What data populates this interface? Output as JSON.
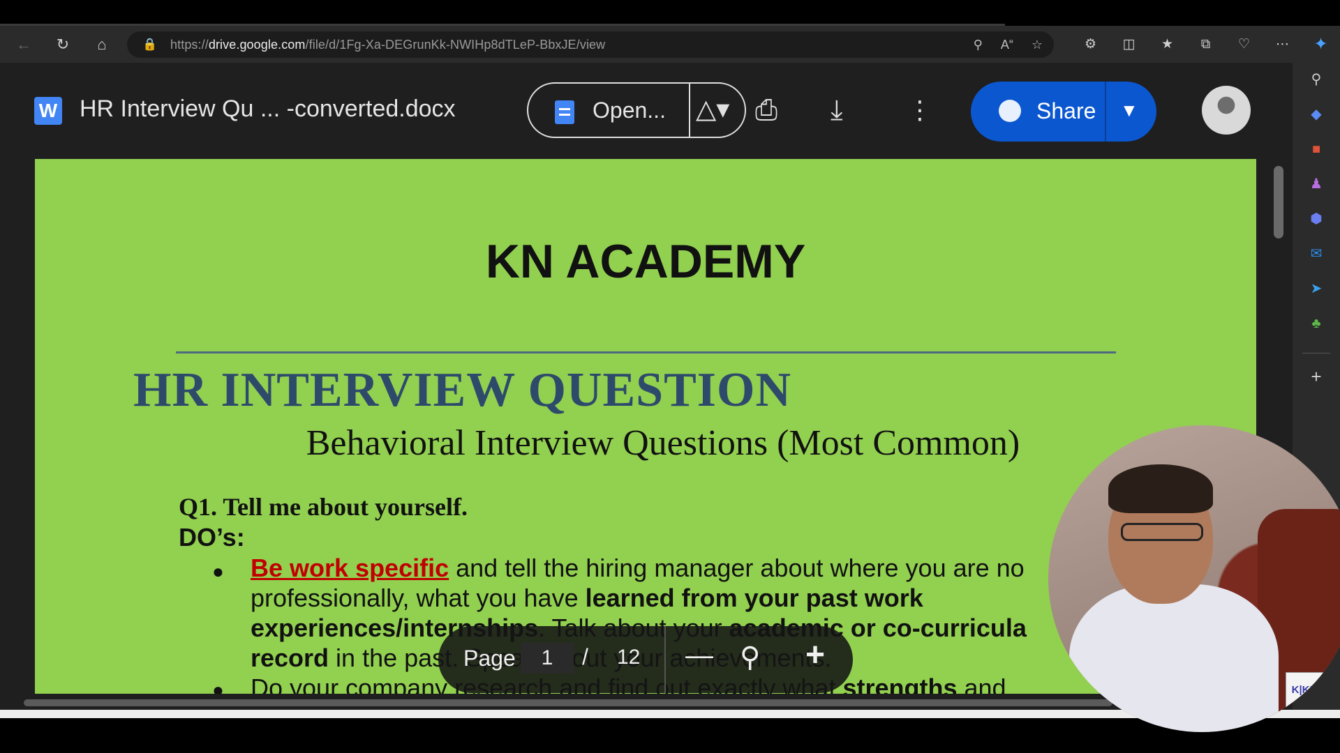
{
  "browser": {
    "url_prefix": "https://",
    "url_domain": "drive.google.com",
    "url_path": "/file/d/1Fg-Xa-DEGrunKk-NWIHp8dTLeP-BbxJE/view"
  },
  "drive": {
    "file_icon_letter": "W",
    "doc_title": "HR Interview Qu ... -converted.docx",
    "open_with_label": "Open...",
    "share_label": "Share"
  },
  "document": {
    "brand": "KN ACADEMY",
    "heading": "HR INTERVIEW QUESTION",
    "subheading": "Behavioral Interview Questions (Most Common)",
    "question": "Q1. Tell me about yourself.",
    "dos_label": "DO’s:",
    "bullet1": {
      "link": "Be work specific",
      "line1_rest": " and tell the hiring manager about where you are no",
      "line2_a": "professionally, what you have ",
      "line2_b": "learned from your past work",
      "line3_a": "experiences/internships",
      "line3_b": ". Talk about your ",
      "line3_c": "academic or co-curricula",
      "line4_a": "record",
      "line4_b": " in the past. Speak about your achievements."
    },
    "bullet2": {
      "line1_a": "Do your company research and find out exactly what ",
      "line1_b": "strengths",
      "line1_c": " and"
    }
  },
  "pager": {
    "label": "Page",
    "current": "1",
    "separator": "/",
    "total": "12"
  },
  "webcam": {
    "logo_text": "K|KN"
  }
}
